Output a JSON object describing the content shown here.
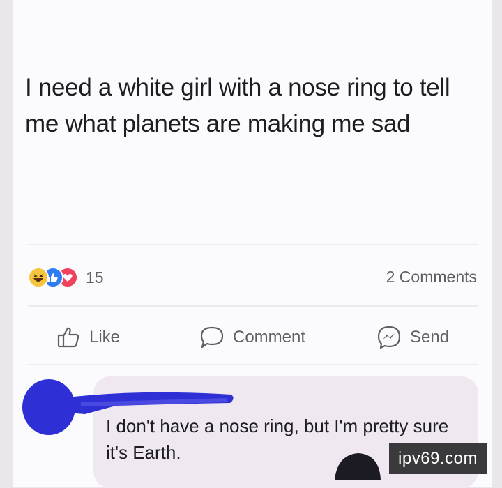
{
  "post": {
    "text": "I need a white girl with a nose ring to tell me what planets are making me sad"
  },
  "reactions": {
    "icons": [
      "haha-icon",
      "like-icon",
      "love-icon"
    ],
    "count": "15"
  },
  "comments_count": "2 Comments",
  "actions": {
    "like": "Like",
    "comment": "Comment",
    "send": "Send"
  },
  "comment": {
    "text": "I don't have a nose ring, but I'm pretty sure it's Earth."
  },
  "watermark": "ipv69.com",
  "colors": {
    "like_blue": "#2f7bf3",
    "love_red": "#f0425c",
    "haha_yellow": "#f6c53d",
    "scribble_blue": "#2f2fd6"
  }
}
